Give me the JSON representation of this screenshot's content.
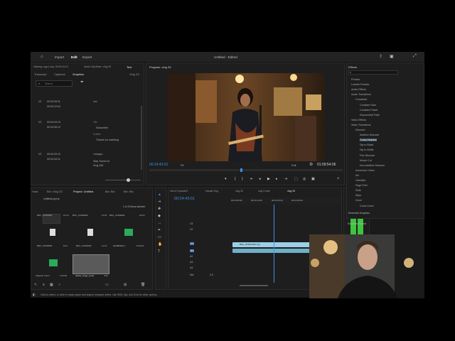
{
  "topbar": {
    "import": "Import",
    "edit": "Edit",
    "export": "Export",
    "title": "Untitled - Edited"
  },
  "text_panel": {
    "header_tabs": [
      "Gaming Logo Loop: 00:04:24:13",
      "Audio Clip Mixer: Vlog 33",
      "Text"
    ],
    "sub_tabs": [
      "Transcript",
      "Captions",
      "Graphics"
    ],
    "sequence": "Vlog 33",
    "search_placeholder": "Search",
    "entries": [
      {
        "track": "V2",
        "tin": "00:03:09:11",
        "tout": "00:03:12:04",
        "lines": [
          "Lev"
        ]
      },
      {
        "track": "V2",
        "tin": "00:04:24:13",
        "tout": "00:04:26:12",
        "lines": [
          "Title",
          "Subscribe!",
          "Subtitle",
          "Thanks for watching"
        ]
      },
      {
        "track": "V2",
        "tin": "00:04:29:12",
        "tout": "00:04:34:11",
        "lines": [
          "<empty>",
          "Stay Tuned for",
          "Vlog #35"
        ]
      }
    ]
  },
  "program": {
    "title": "Program: vlog 33",
    "timecode": "00:24:43:01",
    "fit": "Fit",
    "full": "Full",
    "duration": "01:09:54:06"
  },
  "project": {
    "tabs": [
      "Host",
      "Bin: Vlog 33",
      "Project: Untitled",
      "Bin: Bin",
      "Bin: Bin"
    ],
    "file": "Untitled.prproj",
    "selection": "1 of 20 items selected",
    "items": [
      {
        "name": "BNC_15453826",
        "dur": "13:14"
      },
      {
        "name": "BNC_15453828",
        "dur": "11:22"
      },
      {
        "name": "BNC_15453829",
        "dur": "15:22"
      },
      {
        "name": "",
        "dur": ""
      },
      {
        "name": "BNC_15453845",
        "dur": "8:24"
      },
      {
        "name": "BNC_15453849",
        "dur": "11:13"
      },
      {
        "name": "09188390mf",
        "dur": "6:24:03"
      },
      {
        "name": "",
        "dur": ""
      },
      {
        "name": "Ultgame 4 Ann",
        "dur": "1:24:28"
      },
      {
        "name": "estore_vlogo_comp",
        "dur": "4:24"
      }
    ]
  },
  "timeline": {
    "tabs": [
      "intro17 episode3",
      "Hawaii Vlog",
      "vlog 32",
      "vlog 3 note",
      "vlog 33"
    ],
    "timecode": "00:24:43:01",
    "ruler": [
      "00:24:03:22",
      "00:24:13:22",
      "00:24:23:22",
      "00:24:33:22"
    ],
    "clip_name": "BNC_15463 MOV [V]",
    "tracks": [
      "V3",
      "V2",
      "V1",
      "A1",
      "A2",
      "A3",
      "A4"
    ],
    "mix": "Mix",
    "mix_value": "0.0"
  },
  "effects": {
    "title": "Effects",
    "items": [
      {
        "label": "Presets",
        "level": 0
      },
      {
        "label": "Lumetri Presets",
        "level": 0
      },
      {
        "label": "Audio Effects",
        "level": 0
      },
      {
        "label": "Audio Transitions",
        "level": 0
      },
      {
        "label": "Crossfade",
        "level": 1
      },
      {
        "label": "Constant Gain",
        "level": 2
      },
      {
        "label": "Constant Power",
        "level": 2
      },
      {
        "label": "Exponential Fade",
        "level": 2
      },
      {
        "label": "Video Effects",
        "level": 0
      },
      {
        "label": "Video Transitions",
        "level": 0
      },
      {
        "label": "Dissolve",
        "level": 1
      },
      {
        "label": "Additive Dissolve",
        "level": 2
      },
      {
        "label": "Cross Dissolve",
        "level": 2
      },
      {
        "label": "Dip to Black",
        "level": 2
      },
      {
        "label": "Dip to White",
        "level": 2
      },
      {
        "label": "Film Dissolve",
        "level": 2
      },
      {
        "label": "Morph Cut",
        "level": 2
      },
      {
        "label": "Non-Additive Dissolve",
        "level": 2
      },
      {
        "label": "Immersive Video",
        "level": 1
      },
      {
        "label": "Iris",
        "level": 1
      },
      {
        "label": "Obsolete",
        "level": 1
      },
      {
        "label": "Page Peel",
        "level": 1
      },
      {
        "label": "Slide",
        "level": 1
      },
      {
        "label": "Wipe",
        "level": 1
      },
      {
        "label": "Zoom",
        "level": 1
      },
      {
        "label": "Cross Zoom",
        "level": 2
      }
    ],
    "essential_graphics": "Essential Graphics",
    "essential_sound": "Essential Sound"
  },
  "status": "Click to select, or click in empty space and drag to marquee select. Use Shift, Opt, and Cmd for other options.",
  "colors": {
    "accent": "#3e8ee8",
    "clip": "#9ccfe6",
    "audio": "#6fb0c8",
    "meter": "#3ec43e"
  }
}
